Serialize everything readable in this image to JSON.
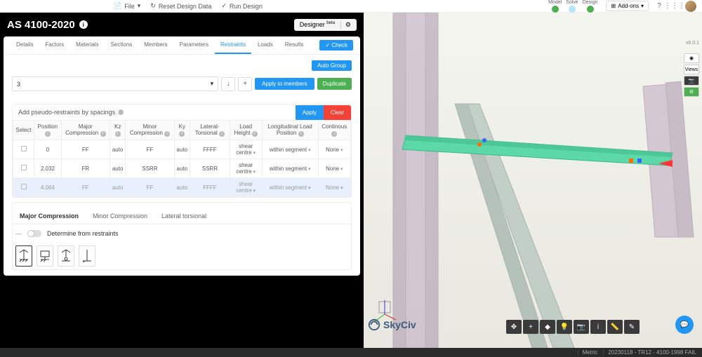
{
  "topbar": {
    "file": "File",
    "reset": "Reset Design Data",
    "run": "Run Design",
    "model": "Model",
    "solve": "Solve",
    "design": "Design",
    "addons": "Add-ons"
  },
  "header": {
    "title": "AS 4100-2020",
    "designer": "Designer",
    "beta": "beta"
  },
  "tabs": {
    "items": [
      "Details",
      "Factors",
      "Materials",
      "Sections",
      "Members",
      "Parameters",
      "Restraints",
      "Loads",
      "Results"
    ],
    "check": "✓ Check",
    "autogroup": "Auto Group"
  },
  "selector": {
    "value": "3",
    "apply_members": "Apply to members",
    "duplicate": "Duplicate"
  },
  "pseudo": {
    "title": "Add pseudo-restraints by spacings",
    "apply": "Apply",
    "clear": "Clear"
  },
  "columns": {
    "select": "Select",
    "position": "Position",
    "major": "Major Compression",
    "kz": "Kz",
    "minor": "Minor Compression",
    "ky": "Ky",
    "lateral": "Lateral-Torsional",
    "load_height": "Load Height",
    "long_load": "Longitudinal Load Position",
    "continuous": "Continous"
  },
  "rows": [
    {
      "pos": "0",
      "maj": "FF",
      "kz": "auto",
      "min": "FF",
      "ky": "auto",
      "lt": "FFFF",
      "lh": "shear centre",
      "llp": "within segment",
      "cont": "None"
    },
    {
      "pos": "2.032",
      "maj": "FR",
      "kz": "auto",
      "min": "SSRR",
      "ky": "auto",
      "lt": "SSRR",
      "lh": "shear centre",
      "llp": "within segment",
      "cont": "None"
    },
    {
      "pos": "4.064",
      "maj": "FF",
      "kz": "auto",
      "min": "FF",
      "ky": "auto",
      "lt": "FFFF",
      "lh": "shear centre",
      "llp": "within segment",
      "cont": "None"
    }
  ],
  "subtabs": {
    "major": "Major Compression",
    "minor": "Minor Compression",
    "lateral": "Lateral torsional",
    "determine": "Determine from restraints"
  },
  "views": "Views",
  "brand": "SkyCiv",
  "status": {
    "metric": "Metric",
    "build": "20230118 - TR12 - 4100-1998 FAIL",
    "ver": "v6.0.1"
  }
}
